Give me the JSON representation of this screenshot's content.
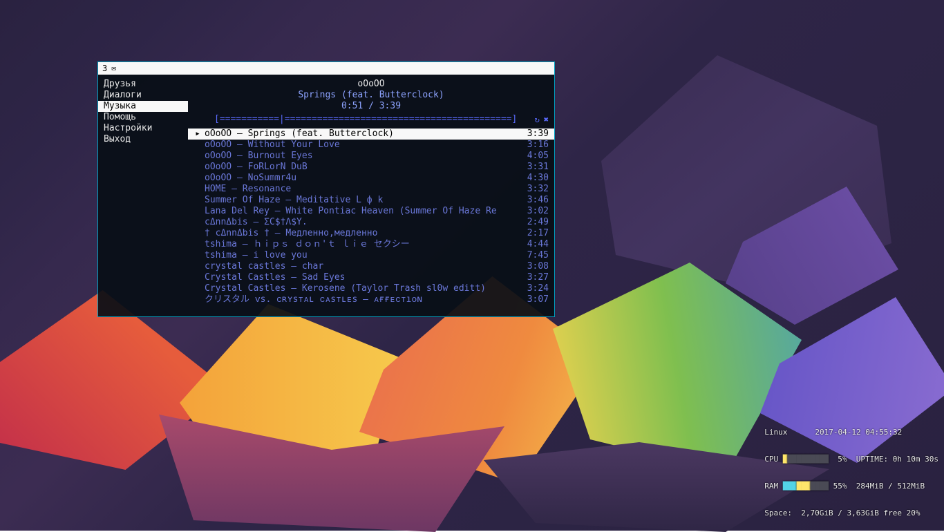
{
  "titlebar": {
    "workspace": "3",
    "mail_glyph": "✉"
  },
  "sidebar": {
    "items": [
      {
        "label": "Друзья"
      },
      {
        "label": "Диалоги"
      },
      {
        "label": "Музыка",
        "selected": true
      },
      {
        "label": "Помощь"
      },
      {
        "label": "Настройки"
      },
      {
        "label": "Выход"
      }
    ]
  },
  "now_playing": {
    "artist": "oOoOO",
    "title": "Springs (feat. Butterclock)",
    "elapsed": "0:51",
    "total": "3:39",
    "progress_bar": "[===========|==========================================]",
    "repeat_glyph": "↻",
    "shuffle_glyph": "✖"
  },
  "playlist": [
    {
      "playing": true,
      "title": "oOoOO – Springs (feat. Butterclock)",
      "dur": "3:39"
    },
    {
      "title": "oOoOO – Without Your Love",
      "dur": "3:16"
    },
    {
      "title": "oOoOO – Burnout Eyes",
      "dur": "4:05"
    },
    {
      "title": "oOoOO – FoRLorN DuB",
      "dur": "3:31"
    },
    {
      "title": "oOoOO – NoSummr4u",
      "dur": "4:30"
    },
    {
      "title": "HOME – Resonance",
      "dur": "3:32"
    },
    {
      "title": "Summer Of Haze – Meditative L ф k",
      "dur": "3:46"
    },
    {
      "title": "Lana Del Rey – White Pontiac Heaven (Summer Of Haze Re",
      "dur": "3:02"
    },
    {
      "title": "cΔnnΔbis – ΣC$†Λ$Y.",
      "dur": "2:49"
    },
    {
      "title": "† cΔnnΔbis †  – Медленно,медленно",
      "dur": "2:17"
    },
    {
      "title": "tshima – ｈｉｐｓ ｄｏｎ'ｔ ｌｉｅ セクシー",
      "dur": "4:44"
    },
    {
      "title": "tshima – i love you",
      "dur": "7:45"
    },
    {
      "title": "crystal castles – char",
      "dur": "3:08"
    },
    {
      "title": "Crystal Castles – Sad Eyes",
      "dur": "3:27"
    },
    {
      "title": "Crystal Castles – Kerosene (Taylor Trash sl0w editt)",
      "dur": "3:24"
    },
    {
      "title": "クリスタル ᴠs. ᴄʀʏsᴛᴀʟ ᴄᴀsᴛʟᴇs  – ᴀғғᴇᴄᴛıᴏɴ",
      "dur": "3:07"
    }
  ],
  "conky": {
    "os": "Linux",
    "datetime": "2017-04-12 04:55:32",
    "cpu": {
      "label": "CPU",
      "bar_on": "█",
      "bar_off": "█████████",
      "pct": "5%"
    },
    "uptime": {
      "label": "UPTIME:",
      "value": "0h 10m 30s"
    },
    "ram": {
      "label": "RAM",
      "bar_c1": "███",
      "bar_c2": "███",
      "bar_off": "████",
      "pct": "55%",
      "used": "284MiB",
      "total": "512MiB"
    },
    "space": {
      "label": "Space:",
      "used": "2,70GiB",
      "total": "3,63GiB",
      "free": "free 20%"
    }
  }
}
